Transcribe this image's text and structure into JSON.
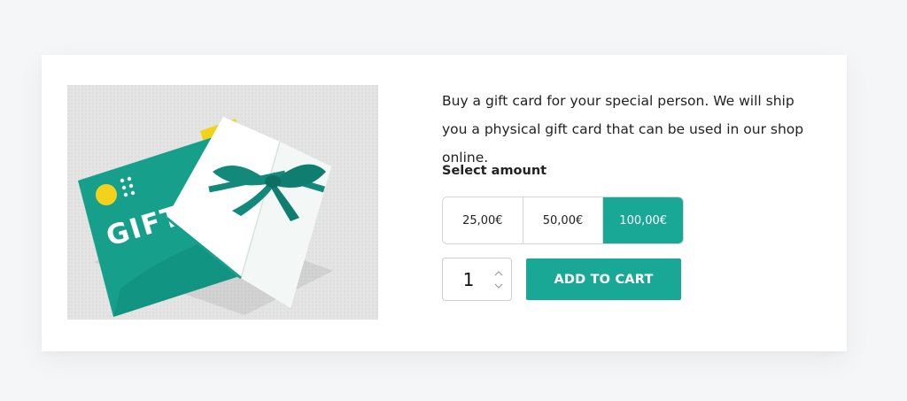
{
  "product": {
    "image_alt": "Gift card with ribbon",
    "card_text": "GIFT CARD",
    "description": "Buy a gift card for your special person. We will ship you a physical gift card that can be used in our shop online."
  },
  "amount_selector": {
    "label": "Select amount",
    "options": [
      "25,00€",
      "50,00€",
      "100,00€"
    ],
    "selected": "100,00€"
  },
  "quantity": {
    "value": "1"
  },
  "actions": {
    "add_to_cart": "ADD TO CART"
  },
  "icons": {
    "quantity_up": "chevron-up-icon",
    "quantity_down": "chevron-down-icon",
    "card_logo": "dot-grid-logo-icon"
  },
  "colors": {
    "accent": "#1aa896",
    "card_teal": "#16a08c",
    "ribbon": "#12897a",
    "logo_yellow": "#f2d21b",
    "page_bg": "#f5f6f7"
  }
}
